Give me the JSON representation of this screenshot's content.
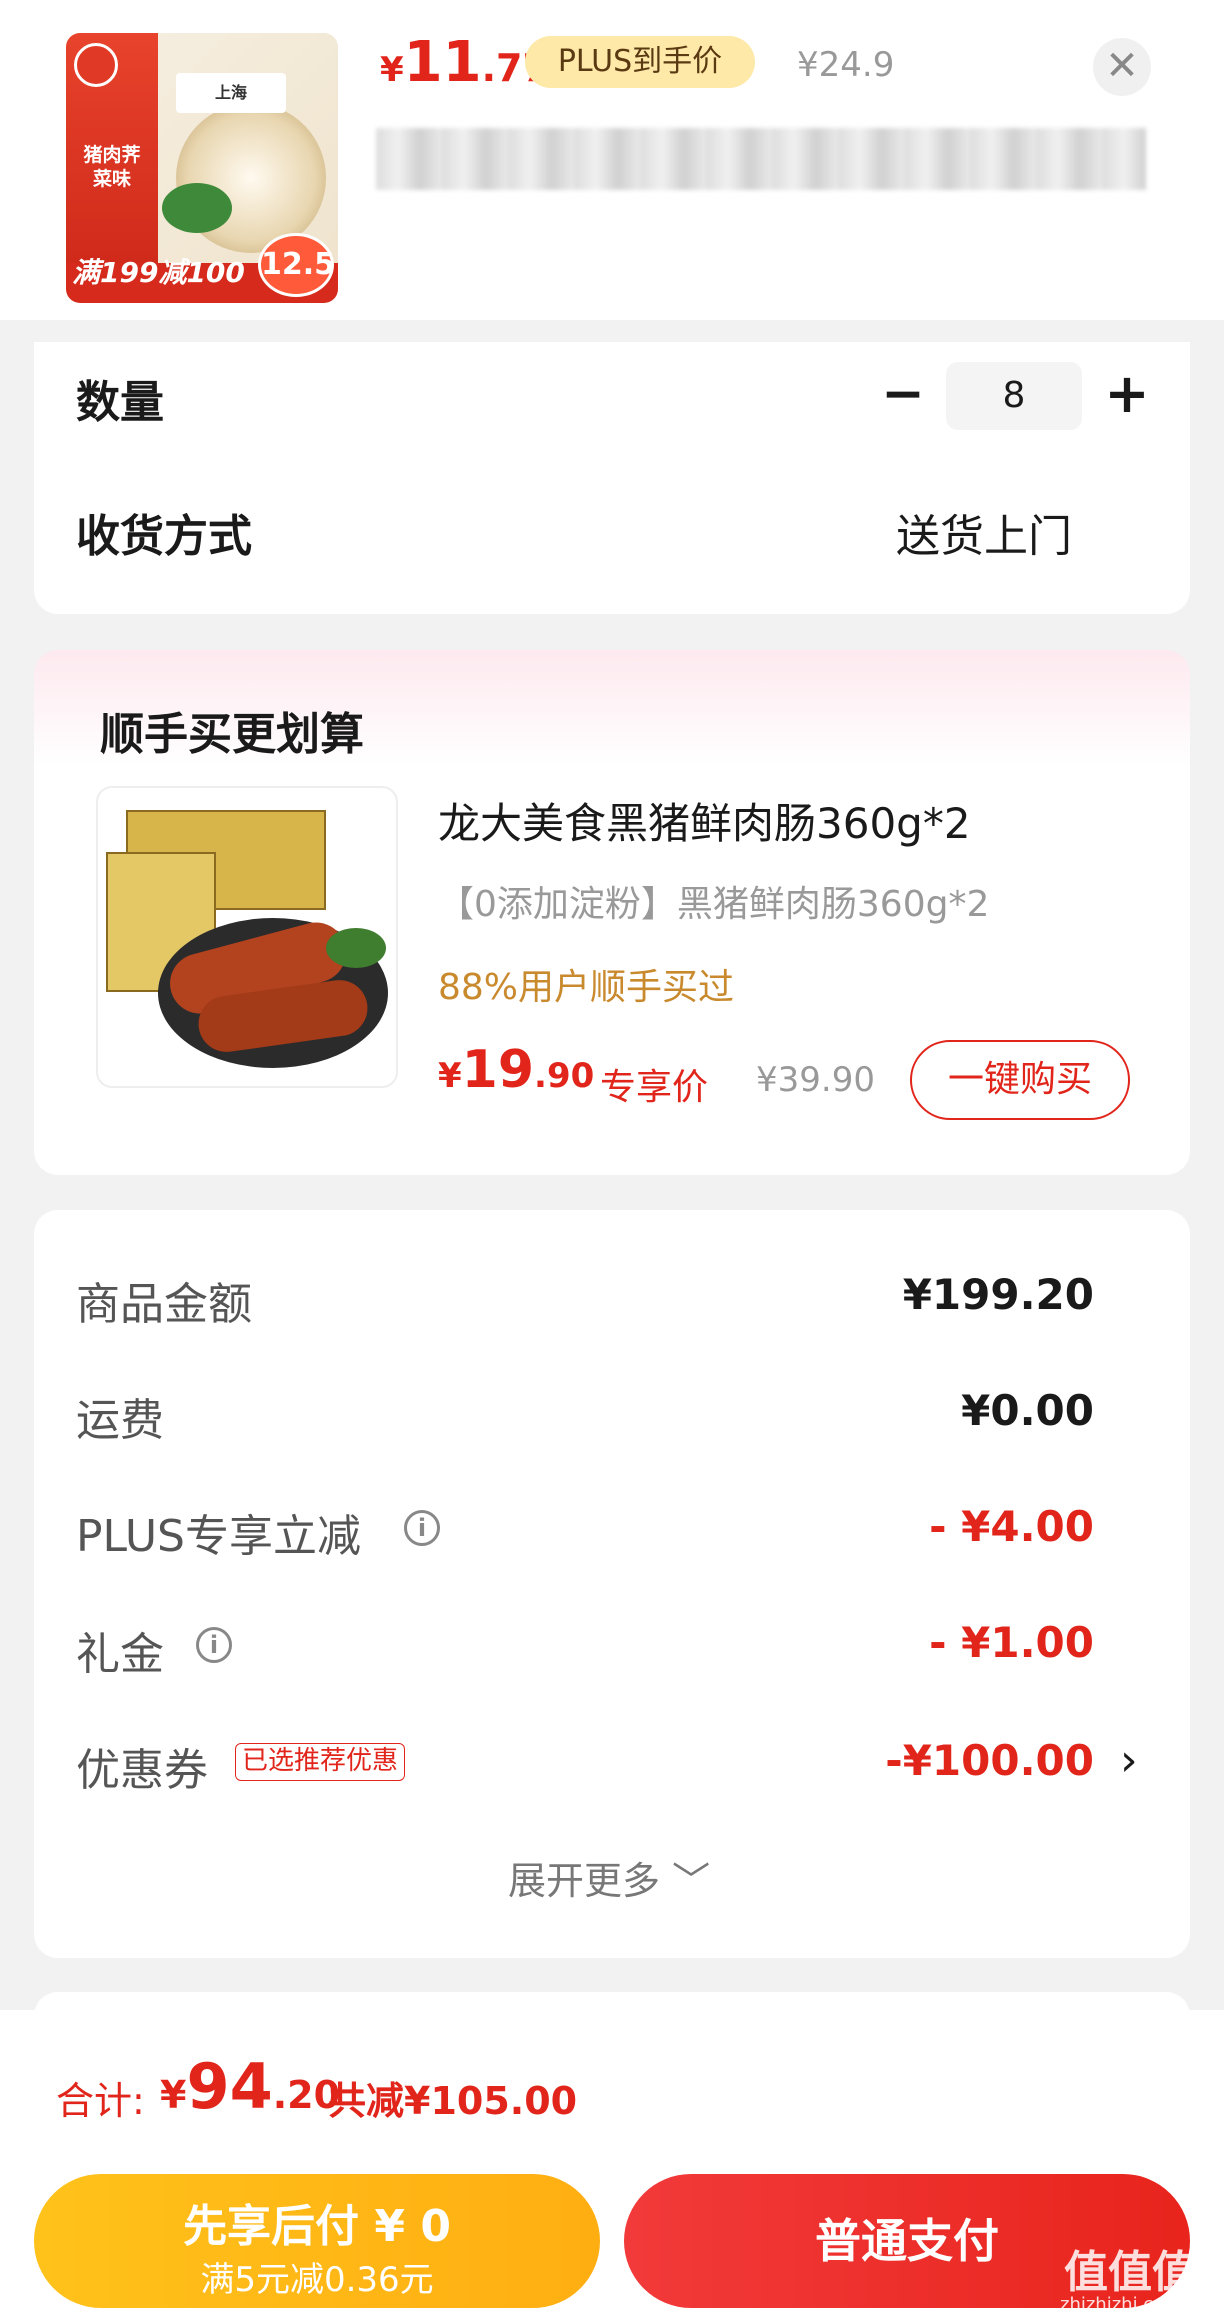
{
  "product": {
    "price_currency": "¥",
    "price_int": "11",
    "price_dec": ".77",
    "plus_tag": "PLUS到手价",
    "original_price": "¥24.9",
    "close_icon": "close-icon",
    "thumb_flavor": "猪肉荠菜味",
    "thumb_promo": "满199减100",
    "thumb_badge": "12.5"
  },
  "order": {
    "quantity_label": "数量",
    "quantity_minus": "−",
    "quantity_value": "8",
    "quantity_plus": "+",
    "delivery_label": "收货方式",
    "delivery_value": "送货上门"
  },
  "recommend": {
    "title": "顺手买更划算",
    "name": "龙大美食黑猪鲜肉肠360g*2",
    "desc": "【0添加淀粉】黑猪鲜肉肠360g*2",
    "social": "88%用户顺手买过",
    "price_currency": "¥",
    "price_int": "19",
    "price_dec": ".90",
    "exclusive": "专享价",
    "original_price": "¥39.90",
    "buy_button": "一键购买"
  },
  "breakdown": {
    "rows": [
      {
        "label": "商品金额",
        "value": "¥199.20"
      },
      {
        "label": "运费",
        "value": "¥0.00"
      },
      {
        "label": "PLUS专享立减",
        "value": "- ¥4.00"
      },
      {
        "label": "礼金",
        "value": "- ¥1.00"
      },
      {
        "label": "优惠券",
        "value": "-¥100.00"
      }
    ],
    "coupon_tag": "已选推荐优惠",
    "expand": "展开更多 ﹀"
  },
  "footer": {
    "total_label": "合计:",
    "total_currency": "¥",
    "total_int": "94",
    "total_dec": ".20",
    "total_saved": "共减¥105.00",
    "later_line1": "先享后付 ¥ 0",
    "later_line2": "满5元减0.36元",
    "pay_button": "普通支付",
    "watermark": "值值值",
    "watermark_sub": "zhizhizhi.com"
  },
  "colors": {
    "accent_red": "#e1251b",
    "plus_gold": "#ffe9a8",
    "later_yellow": "#ffb812"
  }
}
